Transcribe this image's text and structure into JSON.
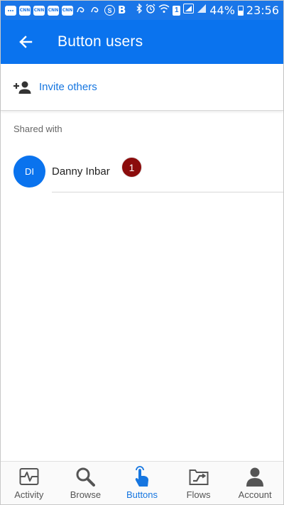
{
  "status_bar": {
    "left_icons": [
      "chat-icon",
      "cnn-icon",
      "cnn-icon",
      "cnn-icon",
      "cnn-icon",
      "swirl-icon",
      "swirl-icon",
      "skype-icon",
      "b-icon"
    ],
    "badge_labels": [
      "CNN",
      "CNN",
      "CNN",
      "CNN"
    ],
    "b_glyph": "B",
    "s_glyph": "S",
    "sim_number": "1",
    "battery": "44%",
    "time": "23:56"
  },
  "app_bar": {
    "title": "Button users"
  },
  "invite": {
    "label": "Invite others"
  },
  "shared": {
    "section_label": "Shared with",
    "users": [
      {
        "initials": "DI",
        "name": "Danny Inbar",
        "badge": "1"
      }
    ]
  },
  "bottom_nav": {
    "items": [
      {
        "label": "Activity",
        "icon": "activity-icon"
      },
      {
        "label": "Browse",
        "icon": "search-icon"
      },
      {
        "label": "Buttons",
        "icon": "touch-icon",
        "active": true
      },
      {
        "label": "Flows",
        "icon": "flows-icon"
      },
      {
        "label": "Account",
        "icon": "account-icon"
      }
    ]
  },
  "colors": {
    "status_bar": "#1a76e8",
    "app_bar": "#0a73ee",
    "accent": "#1676e0",
    "badge": "#8b0c0c"
  }
}
